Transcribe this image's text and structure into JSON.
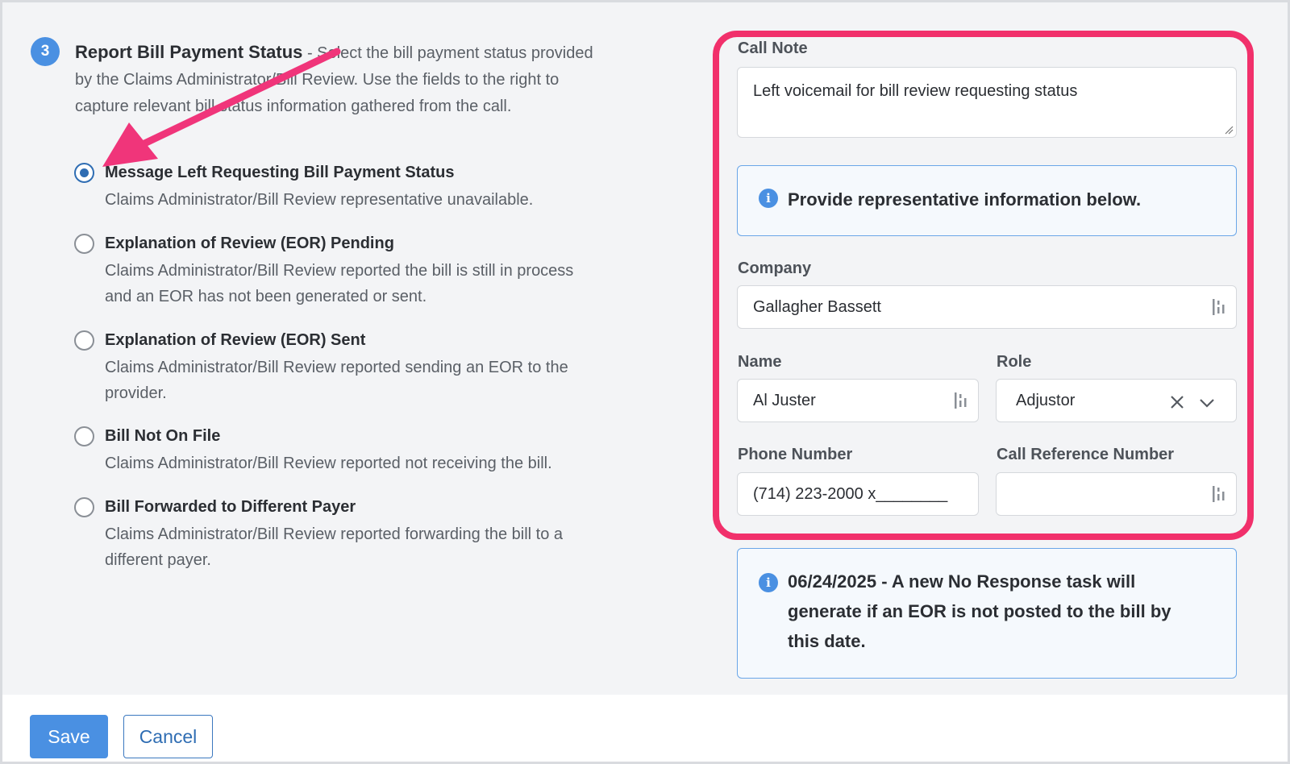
{
  "step": {
    "number": "3",
    "title": "Report Bill Payment Status",
    "description": " - Select the bill payment status provided by the Claims Administrator/Bill Review. Use the fields to the right to capture relevant bill status information gathered from the call."
  },
  "options": [
    {
      "label": "Message Left Requesting Bill Payment Status",
      "desc": "Claims Administrator/Bill Review representative unavailable.",
      "checked": true
    },
    {
      "label": "Explanation of Review (EOR) Pending",
      "desc": "Claims Administrator/Bill Review reported the bill is still in process and an EOR has not been generated or sent.",
      "checked": false
    },
    {
      "label": "Explanation of Review (EOR) Sent",
      "desc": "Claims Administrator/Bill Review reported sending an EOR to the provider.",
      "checked": false
    },
    {
      "label": "Bill Not On File",
      "desc": "Claims Administrator/Bill Review reported not receiving the bill.",
      "checked": false
    },
    {
      "label": "Bill Forwarded to Different Payer",
      "desc": "Claims Administrator/Bill Review reported forwarding the bill to a different payer.",
      "checked": false
    }
  ],
  "form": {
    "call_note_label": "Call Note",
    "call_note_value": "Left voicemail for bill review requesting status",
    "info_message": "Provide representative information below.",
    "company_label": "Company",
    "company_value": "Gallagher Bassett",
    "name_label": "Name",
    "name_value": "Al Juster",
    "role_label": "Role",
    "role_value": "Adjustor",
    "phone_label": "Phone Number",
    "phone_value": "(714) 223-2000 x________",
    "ref_label": "Call Reference Number",
    "ref_value": ""
  },
  "notice": {
    "text": "06/24/2025 - A new No Response task will generate if an EOR is not posted to the bill by this date."
  },
  "footer": {
    "save_label": "Save",
    "cancel_label": "Cancel"
  },
  "colors": {
    "accent": "#4a90e2",
    "highlight": "#f1306b",
    "annotation_arrow": "#f0357a"
  },
  "icons": {
    "info": "info-icon",
    "field_menu": "field-menu-icon",
    "clear": "close-icon",
    "dropdown": "chevron-down-icon"
  }
}
